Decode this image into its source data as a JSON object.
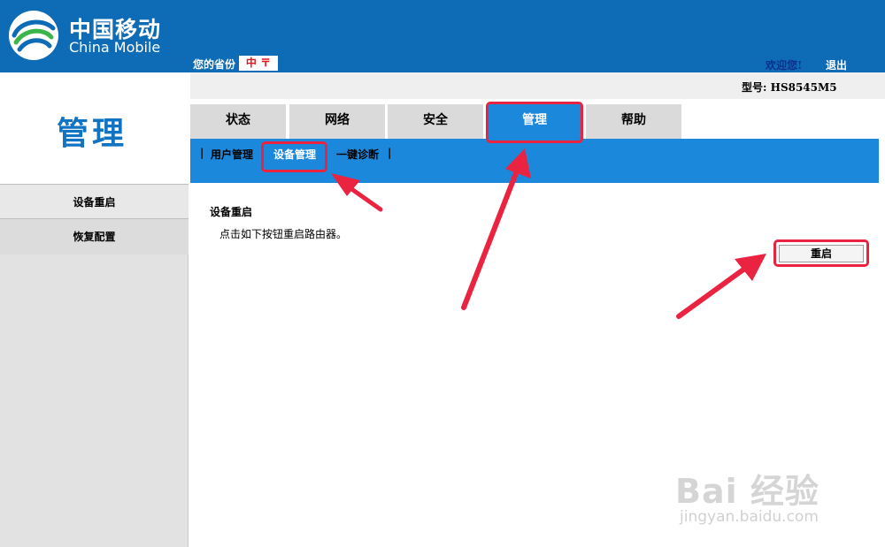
{
  "header": {
    "brand_cn": "中国移动",
    "brand_en": "China Mobile",
    "province_label": "您的省份",
    "province_value": "中 〒",
    "welcome": "欢迎您!",
    "logout": "退出",
    "colors": {
      "primary": "#0e6bb5",
      "accent": "#1b88dc",
      "highlight": "#ea2440"
    }
  },
  "model": "型号: HS8545M5",
  "sidebar": {
    "title": "管理",
    "items": [
      {
        "label": "设备重启",
        "active": true
      },
      {
        "label": "恢复配置",
        "active": false
      }
    ]
  },
  "tabs": [
    {
      "label": "状态"
    },
    {
      "label": "网络"
    },
    {
      "label": "安全"
    },
    {
      "label": "管理",
      "active": true
    },
    {
      "label": "帮助"
    }
  ],
  "subnav": {
    "items": [
      {
        "label": "用户管理"
      },
      {
        "label": "设备管理",
        "active": true
      },
      {
        "label": "一键诊断"
      }
    ],
    "separator": "|"
  },
  "content": {
    "title": "设备重启",
    "description": "点击如下按钮重启路由器。",
    "reboot_button": "重启"
  },
  "watermark": {
    "main": "Bai 经验",
    "sub": "jingyan.baidu.com"
  }
}
